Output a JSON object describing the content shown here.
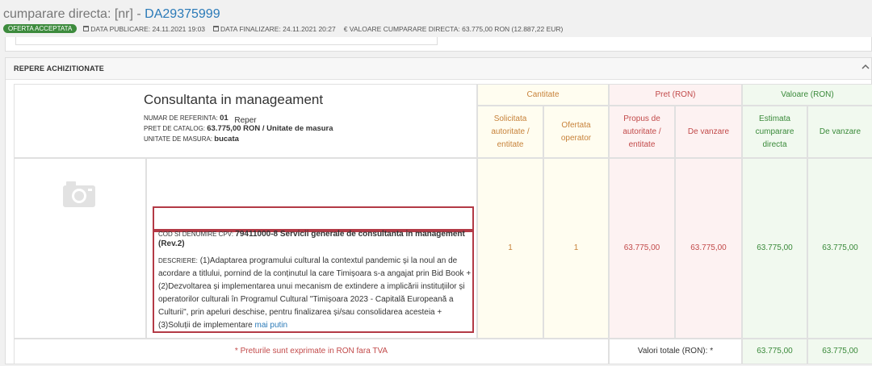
{
  "header": {
    "title_prefix": "cumparare directa: [nr] - ",
    "code": "DA29375999",
    "badge": "OFERTA ACCEPTATA",
    "publish": "DATA PUBLICARE: 24.11.2021 19:03",
    "finalize": "DATA FINALIZARE: 24.11.2021 20:27",
    "value": "€ VALOARE CUMPARARE DIRECTA: 63.775,00  RON (12.887,22  EUR)"
  },
  "section": {
    "title": "REPERE ACHIZITIONATE",
    "collapse_icon": "chevron-up-icon"
  },
  "table": {
    "col_reper": "Reper",
    "group_cantitate": "Cantitate",
    "group_pret": "Pret (RON)",
    "group_valoare": "Valoare (RON)",
    "sub_solicitata": "Solicitata autoritate / entitate",
    "sub_ofertata": "Ofertata operator",
    "sub_propus": "Propus de autoritate / entitate",
    "sub_devanzare1": "De vanzare",
    "sub_estimata": "Estimata cumparare directa",
    "sub_devanzare2": "De vanzare"
  },
  "item": {
    "image_icon": "camera-icon",
    "name": "Consultanta in manageament",
    "ref_label": "NUMAR DE REFERINTA:",
    "ref_value": "01",
    "price_label": "PRET DE CATALOG:",
    "price_value": "63.775,00  RON / Unitate de masura",
    "unit_label": "UNITATE DE MASURA:",
    "unit_value": "bucata",
    "cpv_label": "COD SI DENUMIRE CPV:",
    "cpv_value": "79411000-8 Servicii generale de consultanta in management (Rev.2)",
    "desc_label": "DESCRIERE:",
    "desc_value": "(1)Adaptarea programului cultural la contextul pandemic și la noul an de acordare a titlului, pornind de la conținutul la care Timișoara s-a angajat prin Bid Book + (2)Dezvoltarea și implementarea unui mecanism de extindere a implicării instituțiilor și operatorilor culturali în Programul Cultural \"Timișoara 2023 - Capitală Europeană a Culturii\", prin apeluri deschise, pentru finalizarea și/sau consolidarea acesteia + (3)Soluții de implementare",
    "more_link": "mai putin",
    "solicitata": "1",
    "ofertata": "1",
    "propus": "63.775,00",
    "de_vanzare_pret": "63.775,00",
    "estimata": "63.775,00",
    "de_vanzare_valoare": "63.775,00"
  },
  "footer": {
    "note": "* Preturile sunt exprimate in RON fara TVA",
    "totals_label": "Valori totale (RON): *",
    "total_estimata": "63.775,00",
    "total_vanzare": "63.775,00"
  },
  "colors": {
    "link": "#2a7ab8",
    "badge": "#3d8b3d",
    "highlight_border": "#b33a46"
  }
}
